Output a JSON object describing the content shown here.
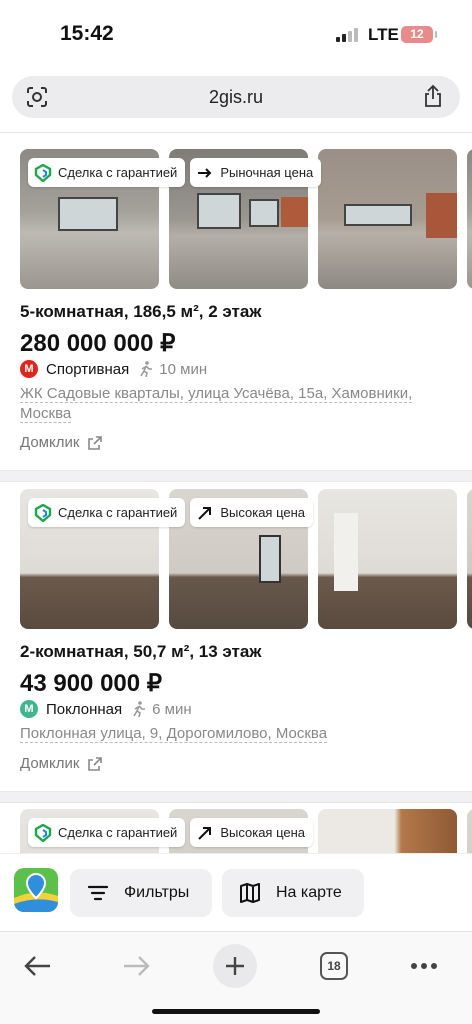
{
  "status_bar": {
    "time": "15:42",
    "network": "LTE",
    "battery": "12"
  },
  "browser": {
    "url": "2gis.ru",
    "tab_count": "18"
  },
  "listings": [
    {
      "badges": [
        {
          "label": "Сделка с гарантией",
          "icon": "guarantee-icon"
        },
        {
          "label": "Рыночная цена",
          "icon": "arrow-right-icon"
        }
      ],
      "title": "5-комнатная, 186,5 м², 2 этаж",
      "price": "280 000 000 ₽",
      "metro": {
        "station": "Спортивная",
        "walk": "10 мин",
        "line_color": "#e0251b",
        "letter": "М"
      },
      "address": "ЖК Садовые кварталы, улица Усачёва, 15а, Хамовники, Москва",
      "source": "Домклик"
    },
    {
      "badges": [
        {
          "label": "Сделка с гарантией",
          "icon": "guarantee-icon"
        },
        {
          "label": "Высокая цена",
          "icon": "arrow-up-right-icon"
        }
      ],
      "title": "2-комнатная, 50,7 м², 13 этаж",
      "price": "43 900 000 ₽",
      "metro": {
        "station": "Поклонная",
        "walk": "6 мин",
        "line_color": "#3fb68e",
        "letter": "М"
      },
      "address": "Поклонная улица, 9, Дорогомилово, Москва",
      "source": "Домклик"
    },
    {
      "badges": [
        {
          "label": "Сделка с гарантией",
          "icon": "guarantee-icon"
        },
        {
          "label": "Высокая цена",
          "icon": "arrow-up-right-icon"
        }
      ]
    }
  ],
  "app_bar": {
    "filters_label": "Фильтры",
    "map_label": "На карте"
  },
  "colors": {
    "guarantee_green": "#1fa64a",
    "accent_blue": "#1e88e5"
  }
}
